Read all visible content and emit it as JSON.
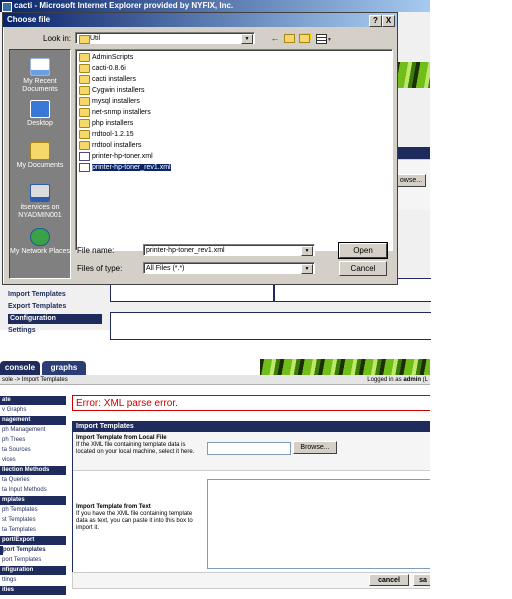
{
  "ie_window": {
    "title": "cacti - Microsoft Internet Explorer provided by NYFIX, Inc."
  },
  "dialog": {
    "title": "Choose file",
    "help_button": "?",
    "close_button": "X",
    "look_in_label": "Look in:",
    "look_in_value": "Util",
    "places": [
      {
        "label": "My Recent Documents",
        "icon": "recent-documents-icon"
      },
      {
        "label": "Desktop",
        "icon": "desktop-icon"
      },
      {
        "label": "My Documents",
        "icon": "my-documents-icon"
      },
      {
        "label": "itservices on NYADMIN001",
        "icon": "computer-icon"
      },
      {
        "label": "My Network Places",
        "icon": "network-places-icon"
      }
    ],
    "files": [
      {
        "name": "AdminScripts",
        "type": "folder"
      },
      {
        "name": "cacti-0.8.6i",
        "type": "folder"
      },
      {
        "name": "cacti installers",
        "type": "folder"
      },
      {
        "name": "Cygwin installers",
        "type": "folder"
      },
      {
        "name": "mysql installers",
        "type": "folder"
      },
      {
        "name": "net-snmp installers",
        "type": "folder"
      },
      {
        "name": "php installers",
        "type": "folder"
      },
      {
        "name": "rrdtool-1.2.15",
        "type": "folder"
      },
      {
        "name": "rrdtool installers",
        "type": "folder"
      },
      {
        "name": "printer-hp-toner.xml",
        "type": "xml"
      },
      {
        "name": "printer-hp-toner_rev1.xml",
        "type": "xml",
        "selected": true
      }
    ],
    "file_name_label": "File name:",
    "file_name_value": "printer-hp-toner_rev1.xml",
    "files_of_type_label": "Files of type:",
    "files_of_type_value": "All Files (*.*)",
    "open_button": "Open",
    "cancel_button": "Cancel"
  },
  "behind_top": {
    "browse_button": "owse...",
    "menu": [
      {
        "label": "Import Templates",
        "kind": "link"
      },
      {
        "label": "Export Templates",
        "kind": "link"
      },
      {
        "label": "Configuration",
        "kind": "head"
      },
      {
        "label": "Settings",
        "kind": "link"
      }
    ]
  },
  "cacti": {
    "tabs": [
      "console",
      "graphs"
    ],
    "breadcrumb": "sole -> Import Templates",
    "logged_in_prefix": "Logged in as",
    "logged_in_user": "admin",
    "logged_in_suffix": "(L",
    "error": "Error: XML parse error.",
    "menu": [
      {
        "label": "ate",
        "kind": "head"
      },
      {
        "label": "v Graphs",
        "kind": "item"
      },
      {
        "label": "nagement",
        "kind": "head"
      },
      {
        "label": "ph Management",
        "kind": "item"
      },
      {
        "label": "ph Trees",
        "kind": "item"
      },
      {
        "label": "ta Sources",
        "kind": "item"
      },
      {
        "label": "vices",
        "kind": "item"
      },
      {
        "label": "llection Methods",
        "kind": "head"
      },
      {
        "label": "ta Queries",
        "kind": "item"
      },
      {
        "label": "ta Input Methods",
        "kind": "item"
      },
      {
        "label": "mplates",
        "kind": "head"
      },
      {
        "label": "ph Templates",
        "kind": "item"
      },
      {
        "label": "st Templates",
        "kind": "item"
      },
      {
        "label": "ta Templates",
        "kind": "item"
      },
      {
        "label": "port/Export",
        "kind": "head"
      },
      {
        "label": "port Templates",
        "kind": "item",
        "current": true
      },
      {
        "label": "port Templates",
        "kind": "item"
      },
      {
        "label": "nfiguration",
        "kind": "head"
      },
      {
        "label": "ttings",
        "kind": "item"
      },
      {
        "label": "ities",
        "kind": "head"
      }
    ],
    "import_header": "Import Templates",
    "from_file_title": "Import Template from Local File",
    "from_file_desc": "If the XML file containing template data is located on your local machine, select it here.",
    "browse_button": "Browse...",
    "from_text_title": "Import Template from Text",
    "from_text_desc": "If you have the XML file containing template data as text, you can paste it into this box to import it.",
    "cancel_button": "cancel",
    "save_button": "sa"
  },
  "colors": {
    "titlebar": "#0a246a",
    "cacti_navy": "#1e2b5c",
    "error_red": "#cc0000",
    "dialog_face": "#d4d0c8",
    "places_bar": "#808080"
  }
}
